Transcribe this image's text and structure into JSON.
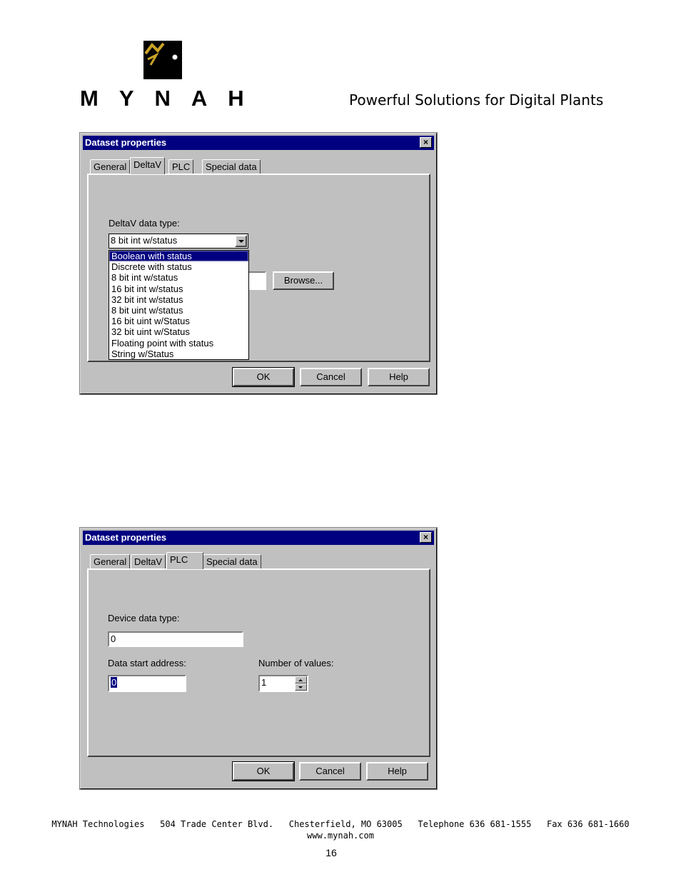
{
  "header": {
    "logo_text": "MYNAH",
    "tagline": "Powerful Solutions for Digital Plants"
  },
  "dialog1": {
    "title": "Dataset properties",
    "close": "×",
    "tabs": [
      "General",
      "DeltaV",
      "PLC",
      "Special data"
    ],
    "active_tab": "DeltaV",
    "datatype_label": "DeltaV data type:",
    "datatype_value": "8 bit int w/status",
    "browse_label": "Browse...",
    "dropdown_options": [
      "Boolean with status",
      "Discrete with status",
      "8 bit int w/status",
      "16 bit int w/status",
      "32 bit int w/status",
      "8 bit uint w/status",
      "16 bit uint w/Status",
      "32 bit uint w/Status",
      "Floating point with status",
      "String w/Status"
    ],
    "highlighted_option": "Boolean with status",
    "ok": "OK",
    "cancel": "Cancel",
    "help": "Help"
  },
  "dialog2": {
    "title": "Dataset properties",
    "close": "×",
    "tabs": [
      "General",
      "DeltaV",
      "PLC",
      "Special data"
    ],
    "active_tab": "PLC",
    "device_type_label": "Device data type:",
    "device_type_value": "0",
    "start_address_label": "Data start address:",
    "start_address_value": "0",
    "num_values_label": "Number of values:",
    "num_values_value": "1",
    "ok": "OK",
    "cancel": "Cancel",
    "help": "Help"
  },
  "footer": {
    "line1": "MYNAH Technologies   504 Trade Center Blvd.   Chesterfield, MO 63005   Telephone 636 681-1555   Fax 636 681-1660",
    "line2": "www.mynah.com",
    "page_number": "16"
  }
}
